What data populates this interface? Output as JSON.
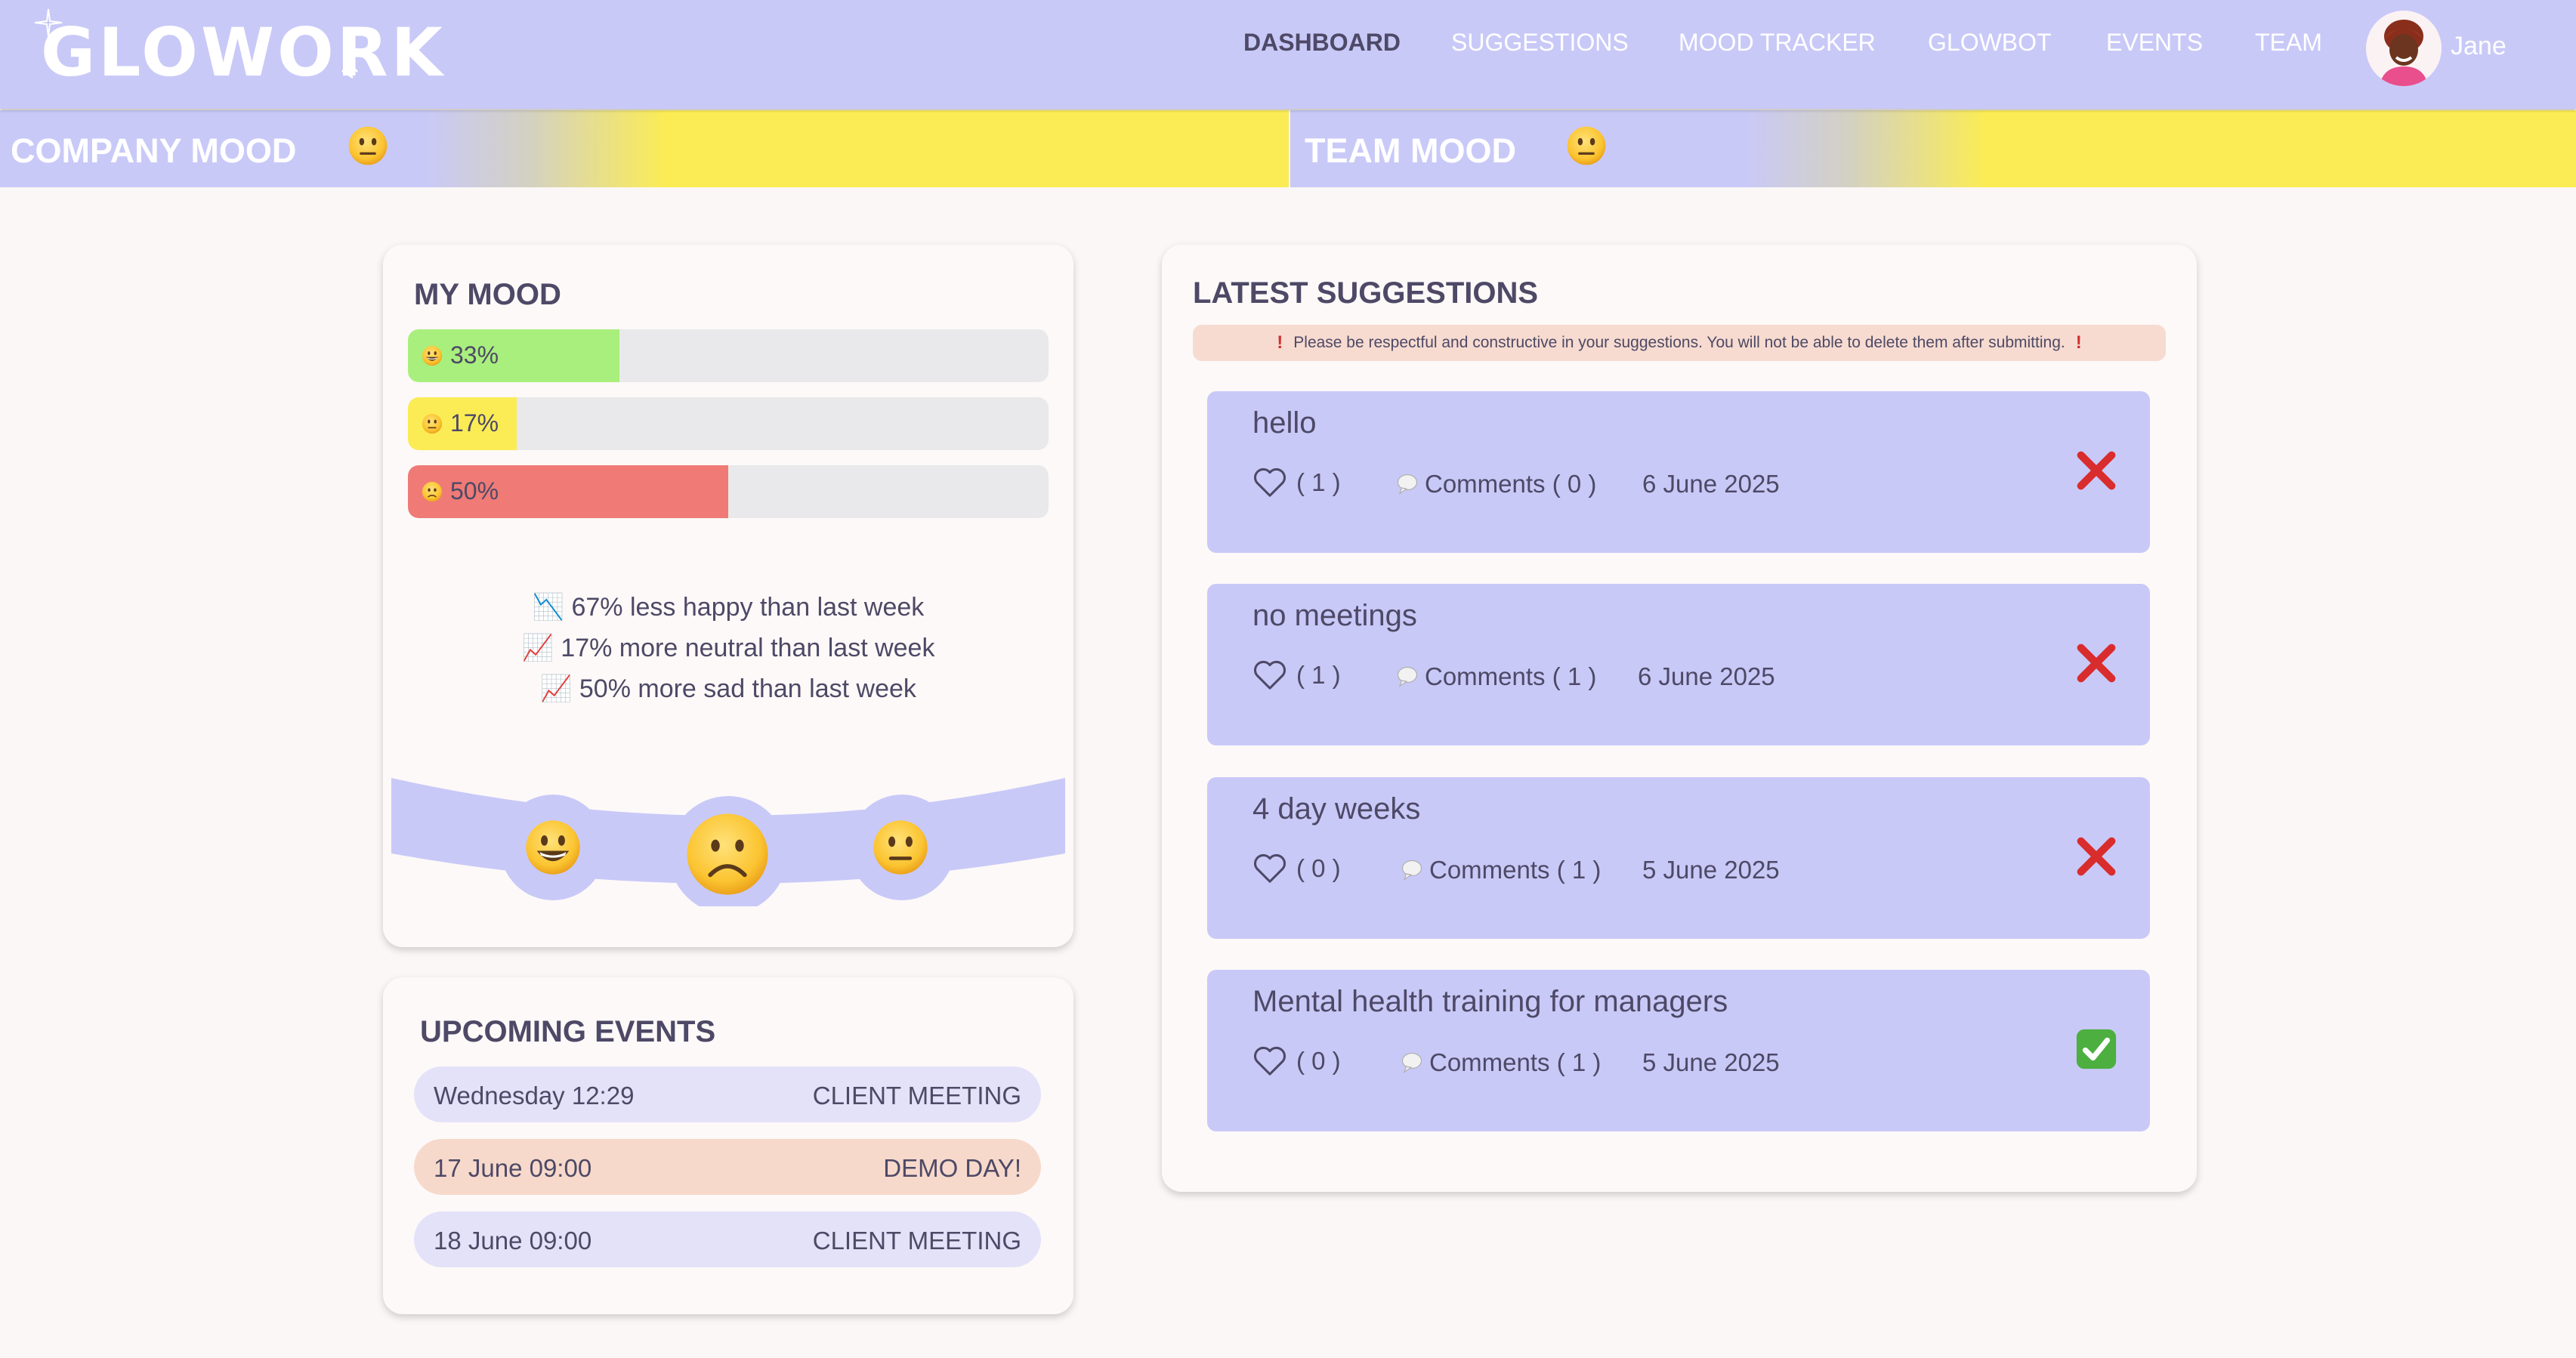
{
  "header": {
    "logo": "GLOWORK",
    "nav": [
      {
        "label": "DASHBOARD",
        "active": true
      },
      {
        "label": "SUGGESTIONS",
        "active": false
      },
      {
        "label": "MOOD TRACKER",
        "active": false
      },
      {
        "label": "GLOWBOT",
        "active": false
      },
      {
        "label": "EVENTS",
        "active": false
      },
      {
        "label": "TEAM",
        "active": false
      }
    ],
    "user_name": "Jane"
  },
  "mood_banner": {
    "company_label": "COMPANY MOOD",
    "company_emoji": "neutral-face",
    "team_label": "TEAM MOOD",
    "team_emoji": "neutral-face"
  },
  "my_mood": {
    "title": "MY MOOD",
    "bars": [
      {
        "emoji": "grinning-face",
        "value": 33,
        "label": "33%",
        "color": "#a9ef7d"
      },
      {
        "emoji": "neutral-face",
        "value": 17,
        "label": "17%",
        "color": "#fbec56"
      },
      {
        "emoji": "sad-face",
        "value": 50,
        "label": "50%",
        "color": "#ef7a76"
      }
    ],
    "stats": [
      "📉 67% less happy than last week",
      "📈 17% more neutral than last week",
      "📈 50% more sad than last week"
    ],
    "selector": [
      "grinning-face",
      "frowning-face",
      "neutral-face"
    ]
  },
  "events": {
    "title": "UPCOMING EVENTS",
    "items": [
      {
        "when": "Wednesday 12:29",
        "what": "CLIENT MEETING",
        "color": "#e3e2f9"
      },
      {
        "when": "17 June 09:00",
        "what": "DEMO DAY!",
        "color": "#f7d9cb"
      },
      {
        "when": "18 June 09:00",
        "what": "CLIENT MEETING",
        "color": "#e3e2f9"
      }
    ]
  },
  "suggestions": {
    "title": "LATEST SUGGESTIONS",
    "notice": "Please be respectful and constructive in your suggestions. You will not be able to delete them after submitting.",
    "items": [
      {
        "title": "hello",
        "likes": "( 1 )",
        "comments": "Comments ( 0 )",
        "date": "6 June 2025",
        "status": "rejected"
      },
      {
        "title": "no meetings",
        "likes": "( 1 )",
        "comments": "Comments ( 1 )",
        "date": "6 June 2025",
        "status": "rejected"
      },
      {
        "title": "4 day weeks",
        "likes": "( 0 )",
        "comments": "Comments ( 1 )",
        "date": "5 June 2025",
        "status": "rejected"
      },
      {
        "title": "Mental health training for managers",
        "likes": "( 0 )",
        "comments": "Comments ( 1 )",
        "date": "5 June 2025",
        "status": "approved"
      }
    ]
  },
  "colors": {
    "header_bg": "#c9c9f8",
    "mood_yellow": "#fbec56",
    "text": "#4d4966",
    "page_bg": "#fbf7f6"
  }
}
